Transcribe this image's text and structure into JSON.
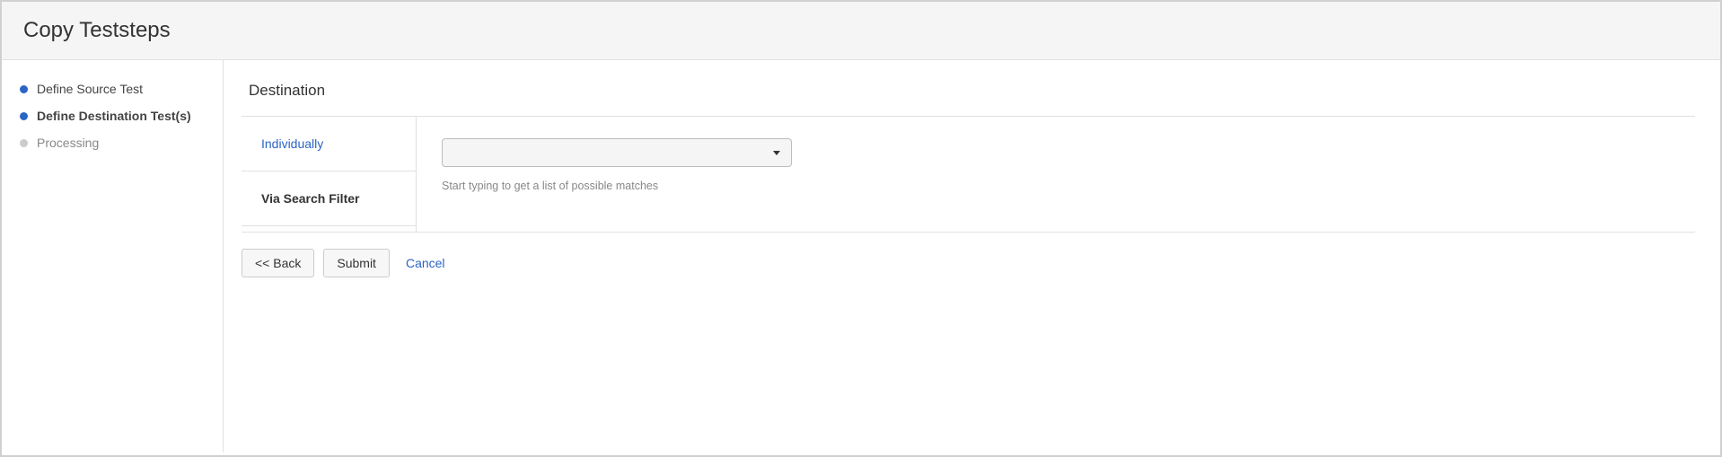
{
  "header": {
    "title": "Copy Teststeps"
  },
  "sidebar": {
    "steps": [
      {
        "label": "Define Source Test",
        "state": "done"
      },
      {
        "label": "Define Destination Test(s)",
        "state": "active"
      },
      {
        "label": "Processing",
        "state": "pending"
      }
    ]
  },
  "main": {
    "section_title": "Destination",
    "tabs": [
      {
        "label": "Individually",
        "selected": true
      },
      {
        "label": "Via Search Filter",
        "selected": false
      }
    ],
    "combo": {
      "value": "",
      "hint": "Start typing to get a list of possible matches"
    },
    "actions": {
      "back": "<< Back",
      "submit": "Submit",
      "cancel": "Cancel"
    }
  }
}
